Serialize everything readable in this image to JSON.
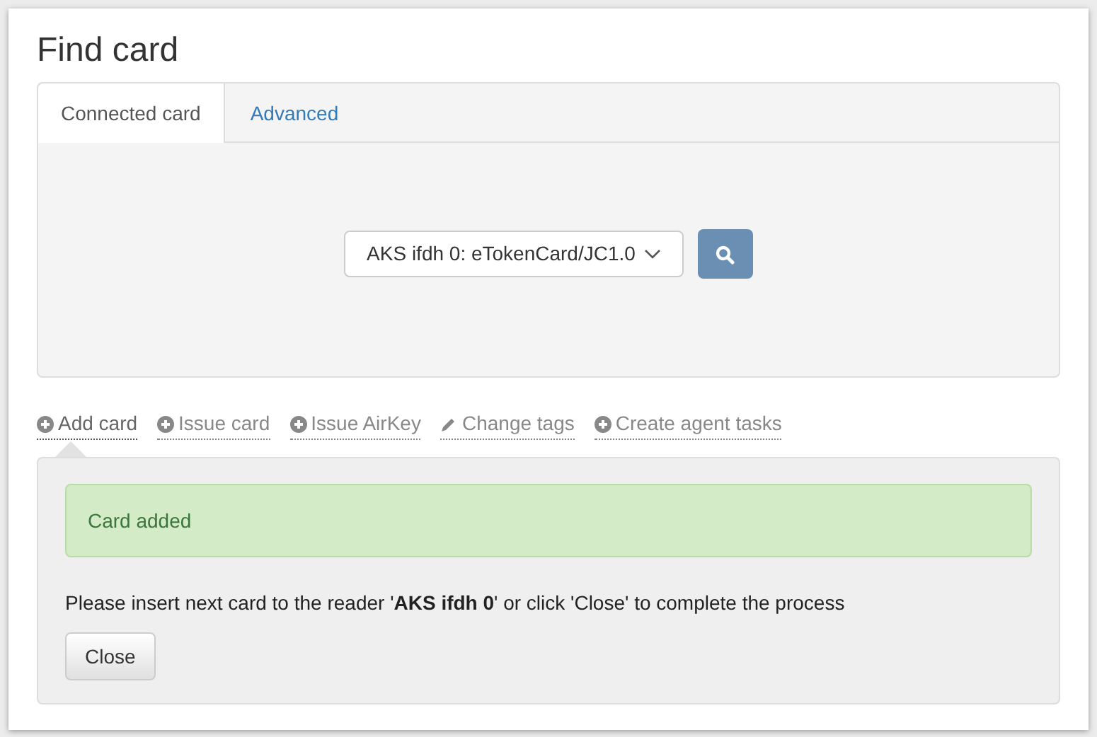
{
  "dialog": {
    "title": "Find card"
  },
  "tabs": [
    {
      "label": "Connected card",
      "selected": true
    },
    {
      "label": "Advanced",
      "selected": false
    }
  ],
  "reader_select": {
    "value": "AKS ifdh 0: eTokenCard/JC1.0"
  },
  "actions": [
    {
      "label": "Add card",
      "kind": "plus",
      "selected": true
    },
    {
      "label": "Issue card",
      "kind": "plus",
      "selected": false
    },
    {
      "label": "Issue AirKey",
      "kind": "plus",
      "selected": false
    },
    {
      "label": "Change tags",
      "kind": "pencil",
      "selected": false
    },
    {
      "label": "Create agent tasks",
      "kind": "plus",
      "selected": false
    }
  ],
  "alert": {
    "text": "Card added"
  },
  "message": "Please insert next card to the reader '**AKS ifdh 0**' or click 'Close' to complete the process",
  "buttons": [
    "Close"
  ]
}
